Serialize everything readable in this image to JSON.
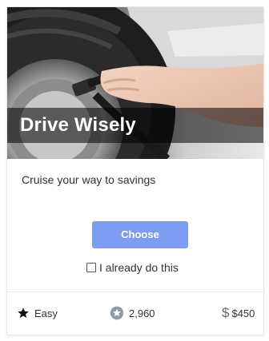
{
  "card": {
    "title": "Drive Wisely",
    "subtitle": "Cruise your way to savings",
    "choose_label": "Choose",
    "already_label": "I already do this",
    "already_checked": false,
    "difficulty": "Easy",
    "points": "2,960",
    "savings": "$450",
    "savings_icon": "$",
    "accent_color": "#7b9cf0",
    "icons": {
      "difficulty": "star-icon",
      "points": "star-badge-icon",
      "savings": "dollar-icon"
    }
  }
}
